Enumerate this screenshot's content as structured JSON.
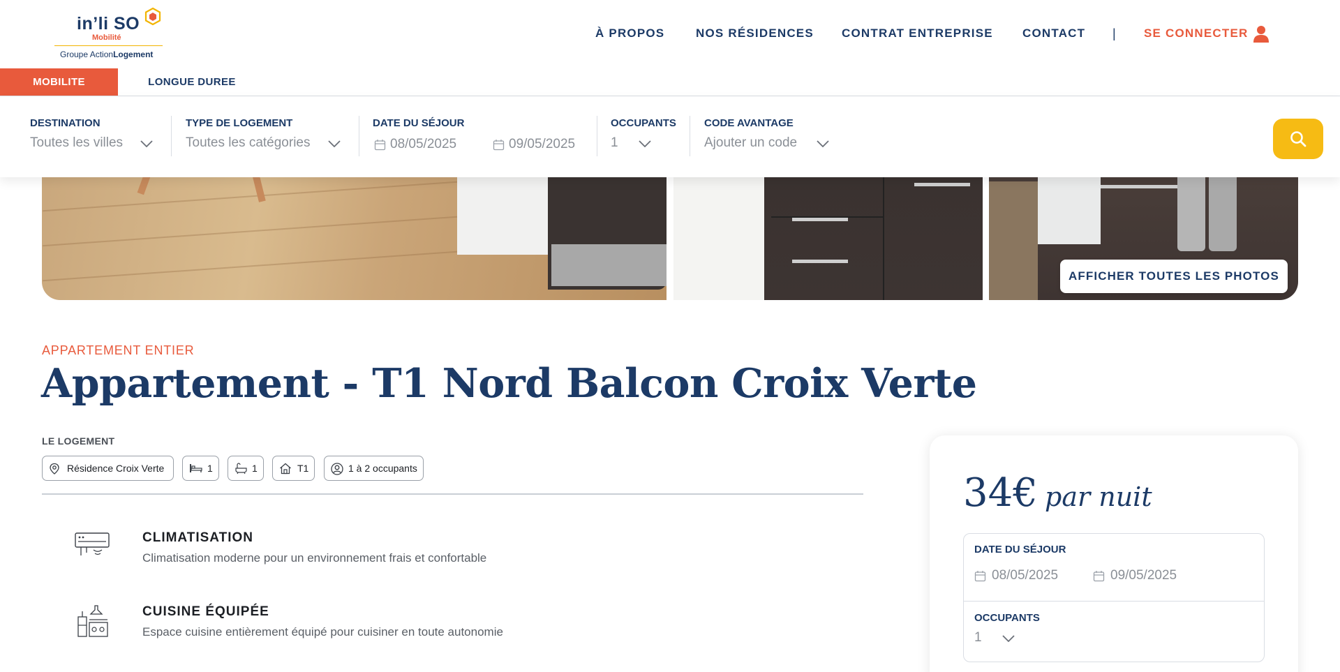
{
  "brand": {
    "name": "in’li SO",
    "subname": "Mobilité",
    "group_prefix": "Groupe Action",
    "group_bold": "Logement"
  },
  "nav": {
    "items": [
      "À PROPOS",
      "NOS RÉSIDENCES",
      "CONTRAT ENTREPRISE",
      "CONTACT"
    ],
    "separator": "|",
    "login": "SE CONNECTER"
  },
  "tabs": {
    "active": "MOBILITE",
    "inactive": "LONGUE DUREE"
  },
  "search": {
    "destination_label": "DESTINATION",
    "destination_value": "Toutes les villes",
    "type_label": "TYPE DE LOGEMENT",
    "type_value": "Toutes les catégories",
    "date_label": "DATE DU SÉJOUR",
    "date_from": "08/05/2025",
    "date_to": "09/05/2025",
    "occupants_label": "OCCUPANTS",
    "occupants_value": "1",
    "code_label": "CODE AVANTAGE",
    "code_value": "Ajouter un code"
  },
  "gallery": {
    "show_all_label": "AFFICHER TOUTES LES PHOTOS"
  },
  "listing": {
    "kicker": "APPARTEMENT ENTIER",
    "title": "Appartement - T1 Nord Balcon Croix Verte",
    "lodging_label": "LE LOGEMENT",
    "chips": {
      "residence": "Résidence Croix Verte",
      "beds": "1",
      "baths": "1",
      "type": "T1",
      "occupants": "1 à 2 occupants"
    },
    "amenities": [
      {
        "title": "CLIMATISATION",
        "desc": "Climatisation moderne pour un environnement frais et confortable"
      },
      {
        "title": "CUISINE ÉQUIPÉE",
        "desc": "Espace cuisine entièrement équipé pour cuisiner en toute autonomie"
      }
    ]
  },
  "booking": {
    "price": "34€",
    "per_night": "par nuit",
    "date_label": "DATE DU SÉJOUR",
    "date_from": "08/05/2025",
    "date_to": "09/05/2025",
    "occupants_label": "OCCUPANTS",
    "occupants_value": "1"
  },
  "colors": {
    "brand_navy": "#1c3a66",
    "accent_orange": "#e85a3c",
    "search_yellow": "#f6bb14"
  }
}
